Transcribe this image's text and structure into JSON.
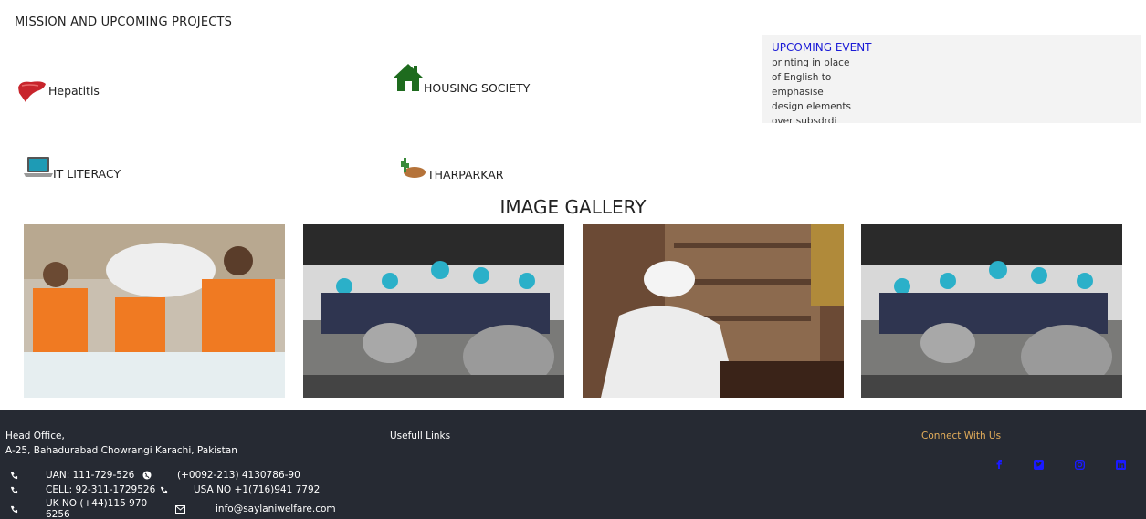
{
  "mission": {
    "title": "MISSION AND UPCOMING PROJECTS"
  },
  "projects": {
    "hepatitis": "Hepatitis",
    "housing": "HOUSING SOCIETY",
    "it_literacy": "IT LITERACY",
    "tharparkar": "THARPARKAR"
  },
  "upcoming": {
    "title": "UPCOMING EVENT",
    "lines": [
      "printing in place",
      "of English to",
      "emphasise",
      "design elements",
      "over subsdrdi"
    ]
  },
  "gallery": {
    "title": "IMAGE GALLERY"
  },
  "footer": {
    "head_office": "Head Office,",
    "address": "A-25, Bahadurabad Chowrangi Karachi, Pakistan",
    "uan": "UAN: 111-729-526",
    "phone": "(+0092-213) 4130786-90",
    "cell": "CELL: 92-311-1729526",
    "usa": "USA NO +1(716)941 7792",
    "uk": "UK NO (+44)115 970 6256",
    "email": "info@saylaniwelfare.com",
    "links_title": "Usefull Links",
    "connect_title": "Connect With Us"
  },
  "colors": {
    "footer_bg": "#262a33",
    "upcoming_title": "#1a1ad6",
    "connect_title": "#e3ad5a",
    "links_underline": "#4fb386",
    "social_icons": "#1a1aff"
  },
  "icons": [
    "liver-icon",
    "house-icon",
    "laptop-icon",
    "tharparkar-icon",
    "phone-icon",
    "globe-icon",
    "envelope-icon",
    "facebook-icon",
    "twitter-icon",
    "instagram-icon",
    "linkedin-icon"
  ]
}
